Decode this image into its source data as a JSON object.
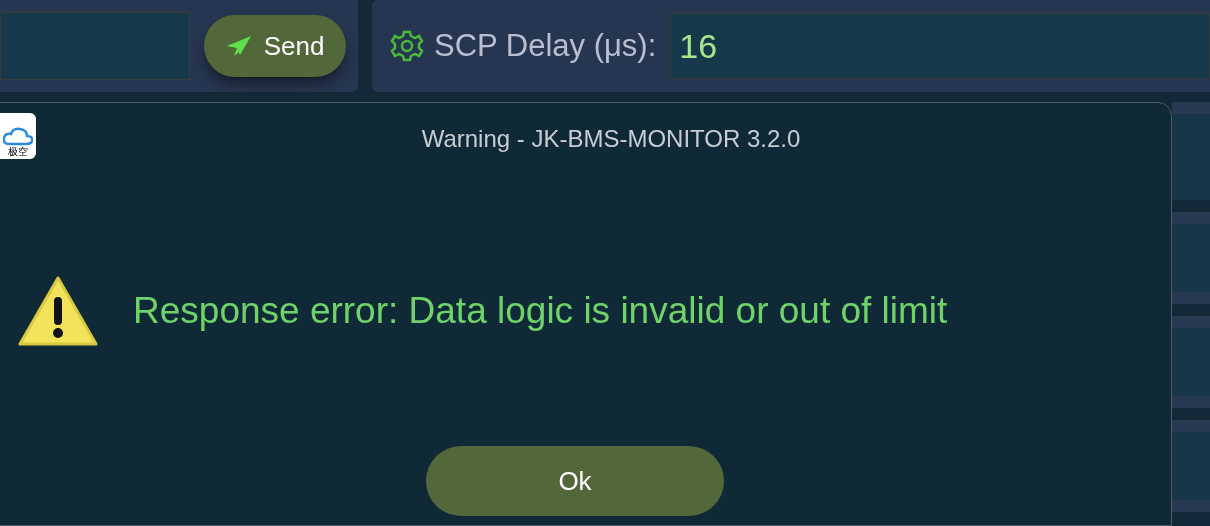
{
  "command_bar": {
    "send_button": "Send"
  },
  "scp_delay": {
    "label": "SCP Delay (μs):",
    "value": "16"
  },
  "dialog": {
    "app_icon_text": "极空",
    "title": "Warning - JK-BMS-MONITOR 3.2.0",
    "message": "Response error: Data logic is invalid or out of limit",
    "button": "Ok"
  }
}
